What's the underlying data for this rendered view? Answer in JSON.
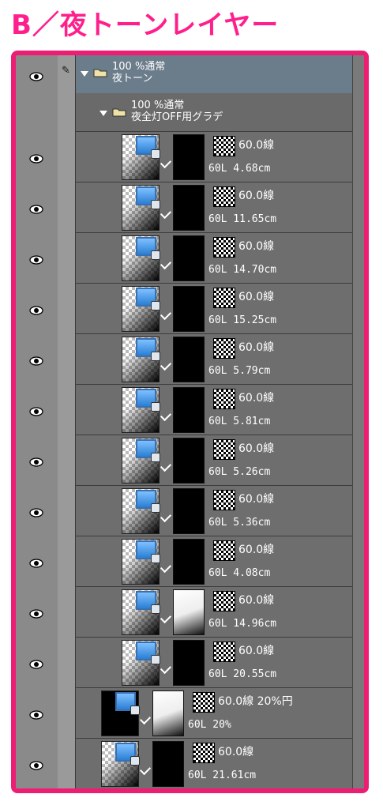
{
  "heading": "B／夜トーンレイヤー",
  "folders": [
    {
      "line1": "100 %通常",
      "line2": "夜トーン"
    },
    {
      "line1": "100 %通常",
      "line2": "夜全灯OFF用グラデ"
    }
  ],
  "layers": [
    {
      "tone": "60.0線",
      "detail": "60L 4.68cm"
    },
    {
      "tone": "60.0線",
      "detail": "60L 11.65cm"
    },
    {
      "tone": "60.0線",
      "detail": "60L 14.70cm"
    },
    {
      "tone": "60.0線",
      "detail": "60L 15.25cm"
    },
    {
      "tone": "60.0線",
      "detail": "60L 5.79cm"
    },
    {
      "tone": "60.0線",
      "detail": "60L 5.81cm"
    },
    {
      "tone": "60.0線",
      "detail": "60L 5.26cm"
    },
    {
      "tone": "60.0線",
      "detail": "60L 5.36cm"
    },
    {
      "tone": "60.0線",
      "detail": "60L 4.08cm"
    },
    {
      "tone": "60.0線",
      "detail": "60L 14.96cm"
    },
    {
      "tone": "60.0線",
      "detail": "60L 20.55cm"
    },
    {
      "tone": "60.0線 20%円",
      "detail": "60L 20%"
    },
    {
      "tone": "60.0線",
      "detail": "60L 21.61cm"
    }
  ],
  "colors": {
    "accent": "#ee1d74",
    "panel": "#6e6e6e"
  }
}
